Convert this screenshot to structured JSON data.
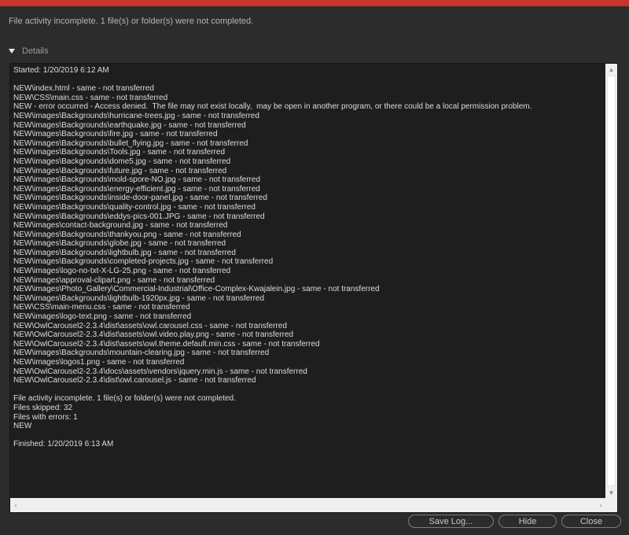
{
  "summary": "File activity incomplete. 1 file(s) or folder(s) were not completed.",
  "details": {
    "label": "Details",
    "expanded": true
  },
  "log": {
    "lines": [
      "Started: 1/20/2019 6:12 AM",
      "",
      "NEW\\index.html - same - not transferred",
      "NEW\\CSS\\main.css - same - not transferred",
      "NEW - error occurred - Access denied.  The file may not exist locally,  may be open in another program, or there could be a local permission problem.",
      "NEW\\images\\Backgrounds\\hurricane-trees.jpg - same - not transferred",
      "NEW\\images\\Backgrounds\\earthquake.jpg - same - not transferred",
      "NEW\\images\\Backgrounds\\fire.jpg - same - not transferred",
      "NEW\\images\\Backgrounds\\bullet_flying.jpg - same - not transferred",
      "NEW\\images\\Backgrounds\\Tools.jpg - same - not transferred",
      "NEW\\images\\Backgrounds\\dome5.jpg - same - not transferred",
      "NEW\\images\\Backgrounds\\future.jpg - same - not transferred",
      "NEW\\images\\Backgrounds\\mold-spore-NO.jpg - same - not transferred",
      "NEW\\images\\Backgrounds\\energy-efficient.jpg - same - not transferred",
      "NEW\\images\\Backgrounds\\inside-door-panel.jpg - same - not transferred",
      "NEW\\images\\Backgrounds\\quality-control.jpg - same - not transferred",
      "NEW\\images\\Backgrounds\\eddys-pics-001.JPG - same - not transferred",
      "NEW\\images\\contact-background.jpg - same - not transferred",
      "NEW\\images\\Backgrounds\\thankyou.png - same - not transferred",
      "NEW\\images\\Backgrounds\\globe.jpg - same - not transferred",
      "NEW\\images\\Backgrounds\\lightbulb.jpg - same - not transferred",
      "NEW\\images\\Backgrounds\\completed-projects.jpg - same - not transferred",
      "NEW\\images\\logo-no-txt-X-LG-25.png - same - not transferred",
      "NEW\\images\\approval-clipart.png - same - not transferred",
      "NEW\\images\\Photo_Gallery\\Commercial-Industrial\\Office-Complex-Kwajalein.jpg - same - not transferred",
      "NEW\\images\\Backgrounds\\lightbulb-1920px.jpg - same - not transferred",
      "NEW\\CSS\\main-menu.css - same - not transferred",
      "NEW\\images\\logo-text.png - same - not transferred",
      "NEW\\OwlCarousel2-2.3.4\\dist\\assets\\owl.carousel.css - same - not transferred",
      "NEW\\OwlCarousel2-2.3.4\\dist\\assets\\owl.video.play.png - same - not transferred",
      "NEW\\OwlCarousel2-2.3.4\\dist\\assets\\owl.theme.default.min.css - same - not transferred",
      "NEW\\images\\Backgrounds\\mountain-clearing.jpg - same - not transferred",
      "NEW\\images\\logos1.png - same - not transferred",
      "NEW\\OwlCarousel2-2.3.4\\docs\\assets\\vendors\\jquery.min.js - same - not transferred",
      "NEW\\OwlCarousel2-2.3.4\\dist\\owl.carousel.js - same - not transferred",
      "",
      "File activity incomplete. 1 file(s) or folder(s) were not completed.",
      "Files skipped: 32",
      "Files with errors: 1",
      "NEW",
      "",
      "Finished: 1/20/2019 6:13 AM"
    ]
  },
  "buttons": {
    "save_log": "Save Log...",
    "hide": "Hide",
    "close": "Close"
  },
  "icons": {
    "details_toggle": "triangle-down-icon",
    "scroll_up": "chevron-up-icon",
    "scroll_down": "chevron-down-icon",
    "scroll_left": "chevron-left-icon",
    "scroll_right": "chevron-right-icon"
  },
  "colors": {
    "title_bar": "#c8352c",
    "window_bg": "#2c2c2c",
    "log_bg": "#1e1e1e",
    "log_text": "#dcdcdc"
  }
}
